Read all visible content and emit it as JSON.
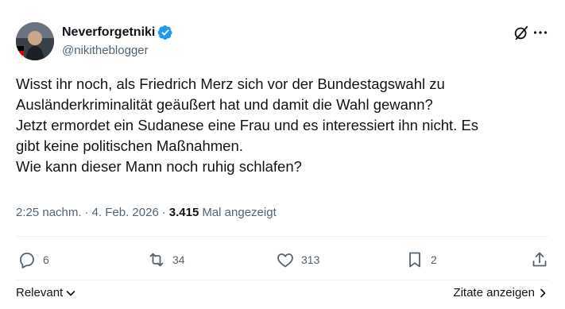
{
  "author": {
    "display_name": "Neverforgetniki",
    "handle": "@nikitheblogger",
    "verified": true,
    "verified_color": "#1d9bf0"
  },
  "tweet": {
    "lines": [
      "Wisst ihr noch, als Friedrich Merz sich vor der Bundestagswahl zu",
      "Ausländerkriminalität geäußert hat und damit die Wahl gewann?",
      "Jetzt ermordet ein Sudanese eine Frau und es interessiert ihn nicht. Es",
      "gibt keine politischen Maßnahmen.",
      "Wie kann dieser Mann noch ruhig schlafen?"
    ]
  },
  "meta": {
    "time": "2:25 nachm.",
    "date": "4. Feb. 2026",
    "views_count": "3.415",
    "views_label": "Mal angezeigt"
  },
  "actions": {
    "replies": "6",
    "reposts": "34",
    "likes": "313",
    "bookmarks": "2"
  },
  "footer": {
    "sort_label": "Relevant",
    "quotes_label": "Zitate anzeigen"
  },
  "icons": {
    "header": [
      "grok-icon",
      "more-icon"
    ],
    "actions": [
      "reply-icon",
      "repost-icon",
      "like-icon",
      "bookmark-icon",
      "share-icon"
    ]
  },
  "colors": {
    "text_primary": "#0f1419",
    "text_secondary": "#536471",
    "divider": "#eff3f4"
  }
}
